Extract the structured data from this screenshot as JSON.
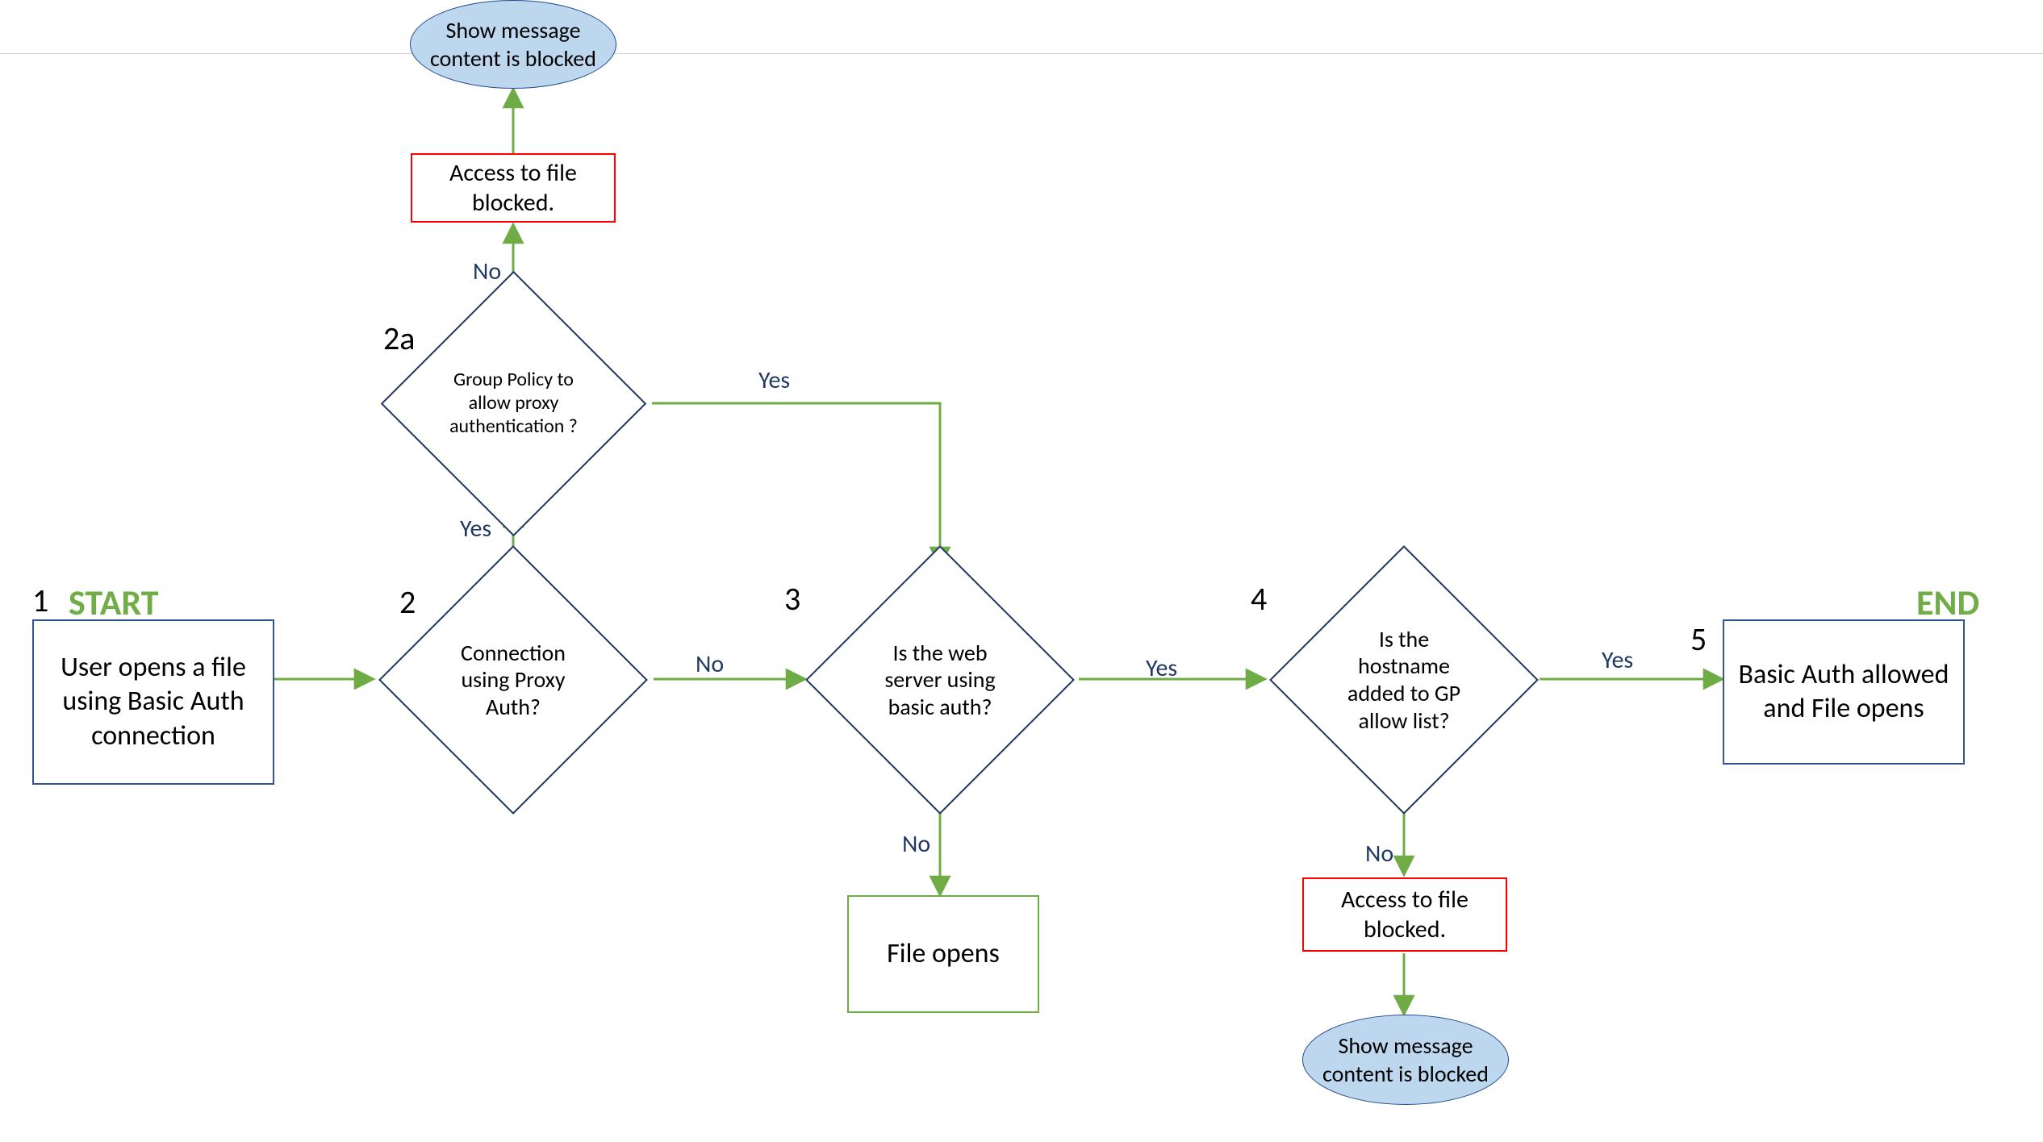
{
  "labels": {
    "start": "START",
    "end": "END",
    "yes": "Yes",
    "no": "No"
  },
  "steps": {
    "s1": "1",
    "s2": "2",
    "s2a": "2a",
    "s3": "3",
    "s4": "4",
    "s5": "5"
  },
  "nodes": {
    "n1": "User opens a file using Basic Auth connection",
    "n2": "Connection using Proxy Auth?",
    "n2a": "Group Policy to allow proxy authentication ?",
    "n2a_no_block": "Access to file blocked.",
    "n2a_no_msg": "Show message content is blocked",
    "n3": "Is the web server using basic auth?",
    "n3_no": "File opens",
    "n4": "Is the hostname added to GP allow list?",
    "n4_no_block": "Access to file blocked.",
    "n4_no_msg": "Show message content is blocked",
    "n5": "Basic Auth allowed and File opens"
  },
  "colors": {
    "arrow": "#6fac46",
    "shape_blue": "#2f5597",
    "shape_red": "#ff0000",
    "shape_green": "#6fac46",
    "diamond_border": "#203864",
    "ellipse_fill": "#bdd7ee",
    "text_blue": "#203864",
    "start_green": "#70ad47"
  }
}
